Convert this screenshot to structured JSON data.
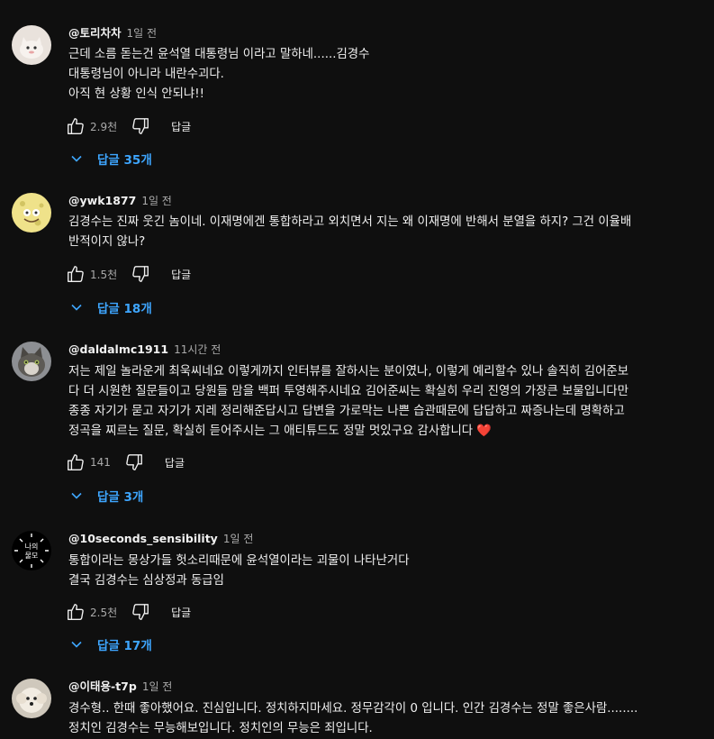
{
  "comments": [
    {
      "handle": "@토리차차",
      "time": "1일 전",
      "avatar_icon": "cat-sticker-avatar",
      "lines": [
        "근데  소름 돋는건  윤석열 대통령님 이라고 말하네......김경수",
        "대통령님이 아니라 내란수괴다.",
        "아직 현 상황 인식 안되냐!!"
      ],
      "likes": "2.9천",
      "reply_label": "답글",
      "replies_label": "답글 35개"
    },
    {
      "handle": "@ywk1877",
      "time": "1일 전",
      "avatar_icon": "sponge-avatar",
      "lines": [
        "김경수는 진짜 웃긴 놈이네. 이재명에겐 통합하라고 외치면서 지는 왜 이재명에 반해서 분열을 하지? 그건 이율배",
        "반적이지 않나?"
      ],
      "likes": "1.5천",
      "reply_label": "답글",
      "replies_label": "답글 18개"
    },
    {
      "handle": "@daldalmc1911",
      "time": "11시간 전",
      "avatar_icon": "cat-photo-avatar",
      "lines": [
        "저는 제일 놀라운게 최욱씨네요 이렇게까지 인터뷰를 잘하시는 분이였나, 이렇게 예리할수 있나 솔직히  김어준보",
        "다 더 시원한 질문들이고  당원들 맘을 백퍼 투영해주시네요 김어준씨는 확실히 우리 진영의 가장큰 보물입니다만",
        "종종 자기가 묻고 자기가 지레 정리해준답시고 답변을 가로막는 나쁜 습관때문에 답답하고 짜증나는데 명확하고",
        "정곡을 찌르는 질문, 확실히 듣어주시는 그 애티튜드도 정말 멋있구요  감사합니다 ❤️"
      ],
      "likes": "141",
      "reply_label": "답글",
      "replies_label": "답글 3개"
    },
    {
      "handle": "@10seconds_sensibility",
      "time": "1일 전",
      "avatar_icon": "text-logo-avatar",
      "avatar_text": "나의\n물모",
      "lines": [
        "통합이라는 몽상가들 헛소리때문에 윤석열이라는 괴물이 나타난거다",
        "결국 김경수는 심상정과 동급임"
      ],
      "likes": "2.5천",
      "reply_label": "답글",
      "replies_label": "답글 17개"
    },
    {
      "handle": "@이태용-t7p",
      "time": "1일 전",
      "avatar_icon": "dog-photo-avatar",
      "lines": [
        "경수형.. 한때 좋아했어요.  진심입니다. 정치하지마세요. 정무감각이 0 입니다. 인간 김경수는 정말 좋은사람........",
        "정치인 김경수는 무능해보입니다. 정치인의 무능은 죄입니다."
      ]
    }
  ],
  "icons": {
    "like": "thumbs-up-icon",
    "dislike": "thumbs-down-icon",
    "expand": "chevron-down-icon"
  },
  "colors": {
    "background": "#0f0f0f",
    "text": "#f1f1f1",
    "secondary": "#aaaaaa",
    "link": "#3ea6ff",
    "heart": "#e0243a"
  }
}
